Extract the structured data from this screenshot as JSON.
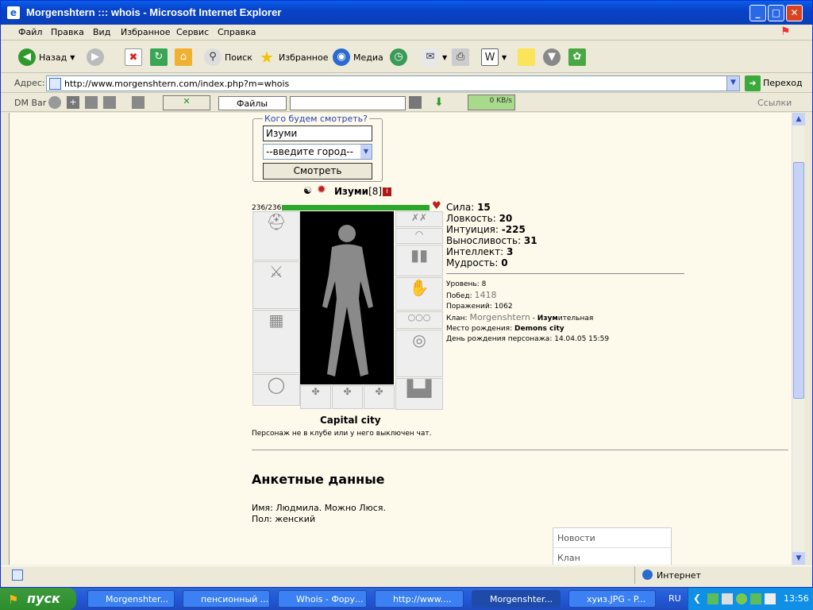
{
  "window": {
    "title": "Morgenshtern ::: whois - Microsoft Internet Explorer"
  },
  "menu": [
    "Файл",
    "Правка",
    "Вид",
    "Избранное",
    "Сервис",
    "Справка"
  ],
  "toolbar": {
    "back": "Назад",
    "search": "Поиск",
    "favorites": "Избранное",
    "media": "Медиа"
  },
  "address": {
    "label": "Адрес:",
    "url": "http://www.morgenshtern.com/index.php?m=whois",
    "go": "Переход"
  },
  "dmbar": {
    "label": "DM Bar",
    "files": "Файлы",
    "speed": "0 KB/s",
    "links": "Ссылки"
  },
  "search_form": {
    "legend": "Кого будем смотреть?",
    "name_value": "Изуми",
    "city_select": "--введите город--",
    "submit": "Смотреть"
  },
  "character": {
    "name": "Изуми",
    "level": "[8]",
    "hp": "236/236",
    "hp_fraction": 1.0,
    "stats": [
      {
        "label": "Сила:",
        "value": "15"
      },
      {
        "label": "Ловкость:",
        "value": "20"
      },
      {
        "label": "Интуиция:",
        "value": "-225"
      },
      {
        "label": "Выносливость:",
        "value": "31"
      },
      {
        "label": "Интеллект:",
        "value": "3"
      },
      {
        "label": "Мудрость:",
        "value": "0"
      }
    ],
    "level_label": "Уровень:",
    "level_value": "8",
    "wins_label": "Побед:",
    "wins_value": "1418",
    "losses_label": "Поражений:",
    "losses_value": "1062",
    "clan_label": "Клан:",
    "clan_value": "Morgenshtern",
    "clan_rank_prefix": "Изум",
    "clan_rank_rest": "ительная",
    "birthplace_label": "Место рождения:",
    "birthplace_value": "Demons city",
    "birthday_label": "День рождения персонажа:",
    "birthday_value": "14.04.05 15:59",
    "city": "Capital city",
    "chat_status": "Персонаж не в клубе или у него выключен чат."
  },
  "profile": {
    "heading": "Анкетные данные",
    "name_line": "Имя: Людмила. Можно Люся.",
    "sex_line": "Пол: женский"
  },
  "sidebar": [
    "Новости",
    "Клан"
  ],
  "status": {
    "zone": "Интернет"
  },
  "taskbar": {
    "start": "пуск",
    "tasks": [
      "Morgenshter...",
      "пенсионный ...",
      "Whois - Фору...",
      "http://www....",
      "Morgenshter...",
      "хуиз.JPG - P..."
    ],
    "lang": "RU",
    "clock": "13:56"
  }
}
